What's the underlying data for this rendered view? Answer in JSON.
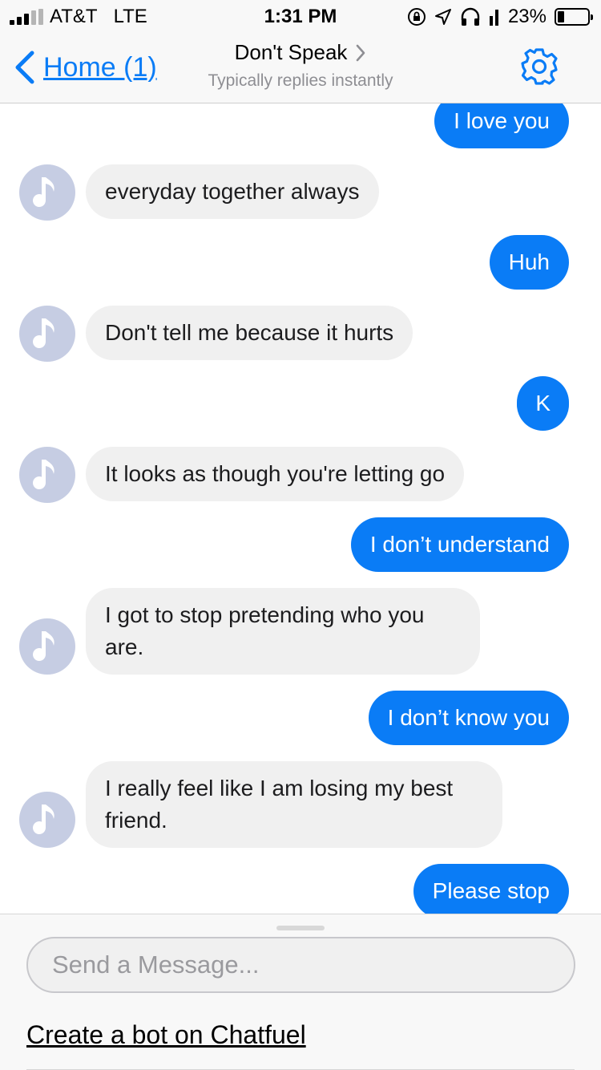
{
  "status_bar": {
    "carrier": "AT&T",
    "network": "LTE",
    "time": "1:31 PM",
    "battery_percent": "23%",
    "battery_level": 0.23,
    "icons": [
      "signal-bars-icon",
      "orientation-lock-icon",
      "location-arrow-icon",
      "headphones-icon",
      "battery-icon"
    ]
  },
  "nav": {
    "back_label": "Home (1)",
    "title": "Don't Speak",
    "subtitle": "Typically replies instantly",
    "accent_color": "#0a7cf6"
  },
  "messages": [
    {
      "direction": "out",
      "text": "I love you"
    },
    {
      "direction": "in",
      "text": "everyday together always"
    },
    {
      "direction": "out",
      "text": "Huh"
    },
    {
      "direction": "in",
      "text": "Don't tell me because it hurts"
    },
    {
      "direction": "out",
      "text": "K"
    },
    {
      "direction": "in",
      "text": "It looks as though you're letting go"
    },
    {
      "direction": "out",
      "text": "I don’t understand"
    },
    {
      "direction": "in",
      "text": "I got to stop pretending who you are."
    },
    {
      "direction": "out",
      "text": "I don’t know you"
    },
    {
      "direction": "in",
      "text": "I really feel like I am losing my best friend."
    },
    {
      "direction": "out",
      "text": "Please stop"
    }
  ],
  "composer": {
    "placeholder": "Send a Message...",
    "value": "",
    "link_label": "Create a bot on Chatfuel"
  },
  "colors": {
    "outgoing_bubble": "#0a7cf6",
    "incoming_bubble": "#f0f0f0",
    "avatar_bg": "#c6cde3"
  }
}
